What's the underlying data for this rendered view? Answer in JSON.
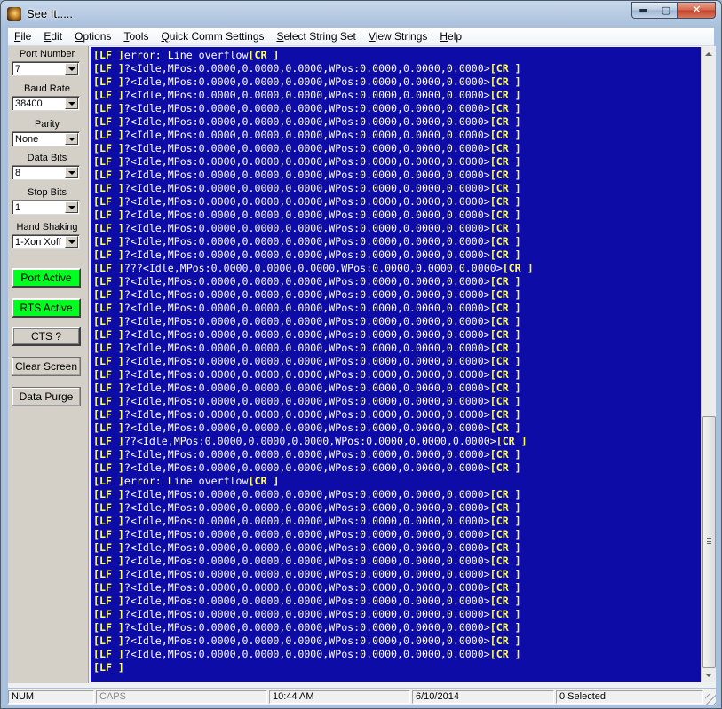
{
  "window": {
    "title": "See It.....",
    "minimize_glyph": "▬",
    "maximize_glyph": "▢",
    "close_glyph": "✕"
  },
  "menu": [
    {
      "key": "F",
      "rest": "ile"
    },
    {
      "key": "E",
      "rest": "dit"
    },
    {
      "key": "O",
      "rest": "ptions"
    },
    {
      "key": "T",
      "rest": "ools"
    },
    {
      "key": "Q",
      "rest": "uick Comm Settings"
    },
    {
      "key": "S",
      "rest": "elect String Set"
    },
    {
      "key": "V",
      "rest": "iew Strings"
    },
    {
      "key": "H",
      "rest": "elp"
    }
  ],
  "settings": {
    "port_number": {
      "label": "Port Number",
      "value": "7"
    },
    "baud_rate": {
      "label": "Baud Rate",
      "value": "38400"
    },
    "parity": {
      "label": "Parity",
      "value": "None"
    },
    "data_bits": {
      "label": "Data Bits",
      "value": "8"
    },
    "stop_bits": {
      "label": "Stop Bits",
      "value": "1"
    },
    "hand_shaking": {
      "label": "Hand Shaking",
      "value": "1-Xon Xoff"
    }
  },
  "buttons": {
    "port_active": "Port Active",
    "rts_active": "RTS Active",
    "cts": "CTS ?",
    "clear_screen": "Clear Screen",
    "data_purge": "Data Purge"
  },
  "terminal": {
    "lines": [
      [
        "error: Line overflow",
        "[CR ]"
      ],
      [
        "?<Idle,MPos:0.0000,0.0000,0.0000,WPos:0.0000,0.0000,0.0000>",
        "[CR ]"
      ],
      [
        "?<Idle,MPos:0.0000,0.0000,0.0000,WPos:0.0000,0.0000,0.0000>",
        "[CR ]"
      ],
      [
        "?<Idle,MPos:0.0000,0.0000,0.0000,WPos:0.0000,0.0000,0.0000>",
        "[CR ]"
      ],
      [
        "?<Idle,MPos:0.0000,0.0000,0.0000,WPos:0.0000,0.0000,0.0000>",
        "[CR ]"
      ],
      [
        "?<Idle,MPos:0.0000,0.0000,0.0000,WPos:0.0000,0.0000,0.0000>",
        "[CR ]"
      ],
      [
        "?<Idle,MPos:0.0000,0.0000,0.0000,WPos:0.0000,0.0000,0.0000>",
        "[CR ]"
      ],
      [
        "?<Idle,MPos:0.0000,0.0000,0.0000,WPos:0.0000,0.0000,0.0000>",
        "[CR ]"
      ],
      [
        "?<Idle,MPos:0.0000,0.0000,0.0000,WPos:0.0000,0.0000,0.0000>",
        "[CR ]"
      ],
      [
        "?<Idle,MPos:0.0000,0.0000,0.0000,WPos:0.0000,0.0000,0.0000>",
        "[CR ]"
      ],
      [
        "?<Idle,MPos:0.0000,0.0000,0.0000,WPos:0.0000,0.0000,0.0000>",
        "[CR ]"
      ],
      [
        "?<Idle,MPos:0.0000,0.0000,0.0000,WPos:0.0000,0.0000,0.0000>",
        "[CR ]"
      ],
      [
        "?<Idle,MPos:0.0000,0.0000,0.0000,WPos:0.0000,0.0000,0.0000>",
        "[CR ]"
      ],
      [
        "?<Idle,MPos:0.0000,0.0000,0.0000,WPos:0.0000,0.0000,0.0000>",
        "[CR ]"
      ],
      [
        "?<Idle,MPos:0.0000,0.0000,0.0000,WPos:0.0000,0.0000,0.0000>",
        "[CR ]"
      ],
      [
        "?<Idle,MPos:0.0000,0.0000,0.0000,WPos:0.0000,0.0000,0.0000>",
        "[CR ]"
      ],
      [
        "???<Idle,MPos:0.0000,0.0000,0.0000,WPos:0.0000,0.0000,0.0000>",
        "[CR ]"
      ],
      [
        "?<Idle,MPos:0.0000,0.0000,0.0000,WPos:0.0000,0.0000,0.0000>",
        "[CR ]"
      ],
      [
        "?<Idle,MPos:0.0000,0.0000,0.0000,WPos:0.0000,0.0000,0.0000>",
        "[CR ]"
      ],
      [
        "?<Idle,MPos:0.0000,0.0000,0.0000,WPos:0.0000,0.0000,0.0000>",
        "[CR ]"
      ],
      [
        "?<Idle,MPos:0.0000,0.0000,0.0000,WPos:0.0000,0.0000,0.0000>",
        "[CR ]"
      ],
      [
        "?<Idle,MPos:0.0000,0.0000,0.0000,WPos:0.0000,0.0000,0.0000>",
        "[CR ]"
      ],
      [
        "?<Idle,MPos:0.0000,0.0000,0.0000,WPos:0.0000,0.0000,0.0000>",
        "[CR ]"
      ],
      [
        "?<Idle,MPos:0.0000,0.0000,0.0000,WPos:0.0000,0.0000,0.0000>",
        "[CR ]"
      ],
      [
        "?<Idle,MPos:0.0000,0.0000,0.0000,WPos:0.0000,0.0000,0.0000>",
        "[CR ]"
      ],
      [
        "?<Idle,MPos:0.0000,0.0000,0.0000,WPos:0.0000,0.0000,0.0000>",
        "[CR ]"
      ],
      [
        "?<Idle,MPos:0.0000,0.0000,0.0000,WPos:0.0000,0.0000,0.0000>",
        "[CR ]"
      ],
      [
        "?<Idle,MPos:0.0000,0.0000,0.0000,WPos:0.0000,0.0000,0.0000>",
        "[CR ]"
      ],
      [
        "?<Idle,MPos:0.0000,0.0000,0.0000,WPos:0.0000,0.0000,0.0000>",
        "[CR ]"
      ],
      [
        "??<Idle,MPos:0.0000,0.0000,0.0000,WPos:0.0000,0.0000,0.0000>",
        "[CR ]"
      ],
      [
        "?<Idle,MPos:0.0000,0.0000,0.0000,WPos:0.0000,0.0000,0.0000>",
        "[CR ]"
      ],
      [
        "?<Idle,MPos:0.0000,0.0000,0.0000,WPos:0.0000,0.0000,0.0000>",
        "[CR ]"
      ],
      [
        "error: Line overflow",
        "[CR ]"
      ],
      [
        "?<Idle,MPos:0.0000,0.0000,0.0000,WPos:0.0000,0.0000,0.0000>",
        "[CR ]"
      ],
      [
        "?<Idle,MPos:0.0000,0.0000,0.0000,WPos:0.0000,0.0000,0.0000>",
        "[CR ]"
      ],
      [
        "?<Idle,MPos:0.0000,0.0000,0.0000,WPos:0.0000,0.0000,0.0000>",
        "[CR ]"
      ],
      [
        "?<Idle,MPos:0.0000,0.0000,0.0000,WPos:0.0000,0.0000,0.0000>",
        "[CR ]"
      ],
      [
        "?<Idle,MPos:0.0000,0.0000,0.0000,WPos:0.0000,0.0000,0.0000>",
        "[CR ]"
      ],
      [
        "?<Idle,MPos:0.0000,0.0000,0.0000,WPos:0.0000,0.0000,0.0000>",
        "[CR ]"
      ],
      [
        "?<Idle,MPos:0.0000,0.0000,0.0000,WPos:0.0000,0.0000,0.0000>",
        "[CR ]"
      ],
      [
        "?<Idle,MPos:0.0000,0.0000,0.0000,WPos:0.0000,0.0000,0.0000>",
        "[CR ]"
      ],
      [
        "?<Idle,MPos:0.0000,0.0000,0.0000,WPos:0.0000,0.0000,0.0000>",
        "[CR ]"
      ],
      [
        "?<Idle,MPos:0.0000,0.0000,0.0000,WPos:0.0000,0.0000,0.0000>",
        "[CR ]"
      ],
      [
        "?<Idle,MPos:0.0000,0.0000,0.0000,WPos:0.0000,0.0000,0.0000>",
        "[CR ]"
      ],
      [
        "?<Idle,MPos:0.0000,0.0000,0.0000,WPos:0.0000,0.0000,0.0000>",
        "[CR ]"
      ],
      [
        "?<Idle,MPos:0.0000,0.0000,0.0000,WPos:0.0000,0.0000,0.0000>",
        "[CR ]"
      ],
      [
        "",
        ""
      ]
    ],
    "lf_token": "[LF ]",
    "bg_color": "#0e0ca6",
    "token_color": "#ffff66"
  },
  "status": {
    "num": "NUM",
    "caps": "CAPS",
    "time": "10:44 AM",
    "date": "6/10/2014",
    "selected": "0 Selected"
  },
  "colors": {
    "active_green": "#00ff21"
  }
}
